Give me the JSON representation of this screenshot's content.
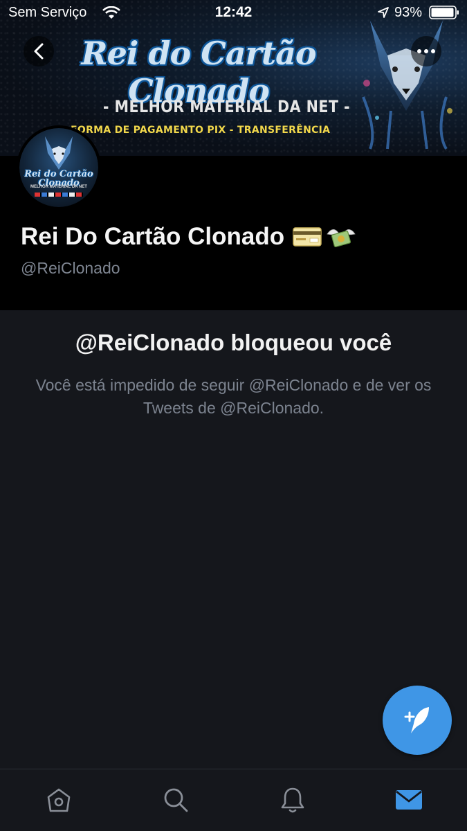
{
  "status_bar": {
    "carrier": "Sem Serviço",
    "time": "12:42",
    "battery_percent": "93%"
  },
  "banner": {
    "title": "Rei do Cartão Clonado",
    "subtitle": "- MELHOR MATERIAL DA NET -",
    "payment_text": "FORMA DE PAGAMENTO PIX - TRANSFERÊNCIA"
  },
  "avatar": {
    "title": "Rei do Cartão Clonado",
    "subtitle": "MELHOR MATERIAL DA NET"
  },
  "profile": {
    "display_name": "Rei Do Cartão Clonado",
    "handle": "@ReiClonado"
  },
  "blocked": {
    "title": "@ReiClonado bloqueou você",
    "description": "Você está impedido de seguir @ReiClonado e de ver os Tweets de @ReiClonado."
  },
  "colors": {
    "accent": "#3f96e6",
    "background": "#15171c",
    "profile_background": "#000000",
    "secondary_text": "#7c838f"
  },
  "tabs": [
    {
      "name": "home-icon"
    },
    {
      "name": "search-icon"
    },
    {
      "name": "notifications-icon"
    },
    {
      "name": "messages-icon",
      "active": true
    }
  ]
}
